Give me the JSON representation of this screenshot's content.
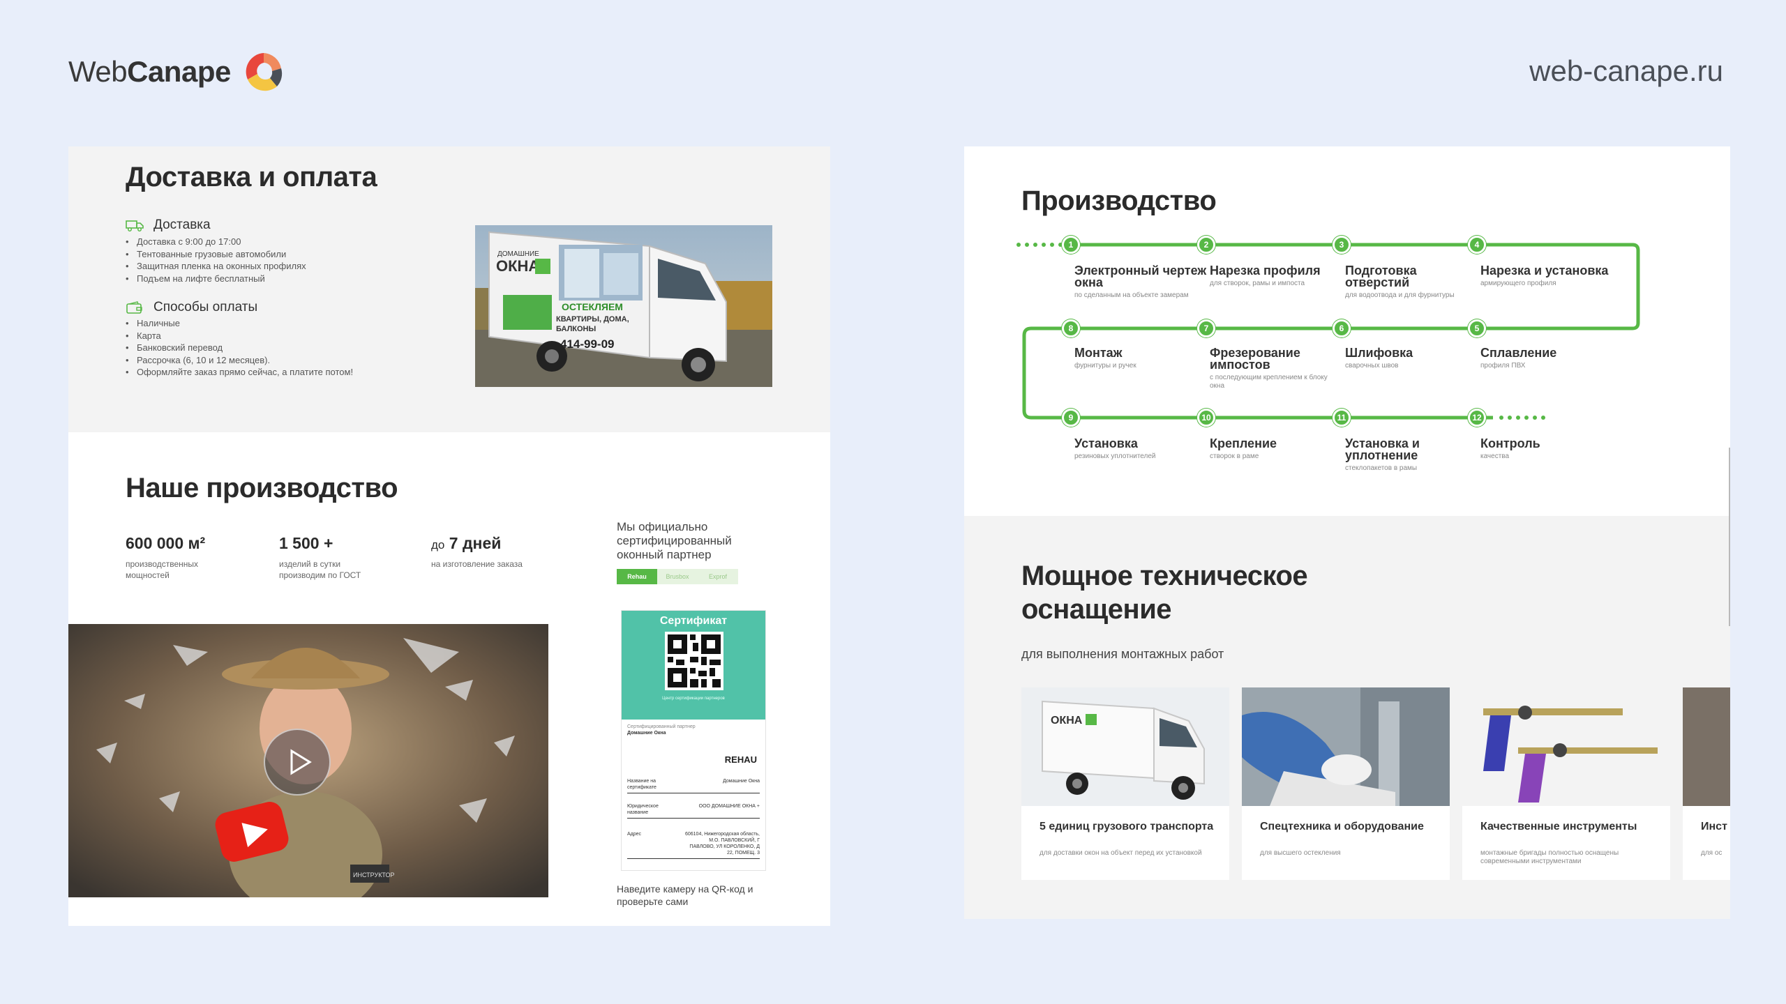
{
  "header": {
    "logo_text_light": "Web",
    "logo_text_bold": "Canape",
    "site_url": "web-canape.ru"
  },
  "left": {
    "delivery_title": "Доставка и оплата",
    "delivery_head": "Доставка",
    "delivery_items": [
      "Доставка с 9:00 до 17:00",
      "Тентованные грузовые автомобили",
      "Защитная пленка на оконных профилях",
      "Подъем на лифте бесплатный"
    ],
    "payment_head": "Способы оплаты",
    "payment_items": [
      "Наличные",
      "Карта",
      "Банковский перевод",
      "Рассрочка (6, 10 и 12 месяцев).",
      "Оформляйте заказ прямо сейчас, а платите потом!"
    ],
    "truck": {
      "brand_small": "ДОМАШНИЕ",
      "brand": "ОКНА",
      "slogan": "ОСТЕКЛЯЕМ",
      "slogan2": "КВАРТИРЫ, ДОМА,",
      "slogan3": "БАЛКОНЫ",
      "phone": "414-99-09"
    },
    "production_title": "Наше производство",
    "stats": [
      {
        "num": "600 000 м²",
        "label1": "производственных",
        "label2": "мощностей"
      },
      {
        "num": "1 500 +",
        "label1": "изделий в сутки",
        "label2": "производим по ГОСТ"
      },
      {
        "num_prefix": "до",
        "num": "7 дней",
        "label1": "на изготовление заказа",
        "label2": ""
      }
    ],
    "partner_text": "Мы официально сертифицированный оконный партнер",
    "brand_tabs": [
      "Rehau",
      "Brusbox",
      "Exprof"
    ],
    "cert": {
      "title": "Сертификат",
      "mini_text": "Центр сертификации партнеров",
      "owner_label": "Сертифицированный партнер",
      "owner": "Домашние Окна",
      "brand": "REHAU",
      "row1_label": "Название на сертификате",
      "row1_value": "Домашние Окна",
      "row2_label": "Юридическое название",
      "row2_value": "ООО ДОМАШНИЕ ОКНА +",
      "row3_label": "Адрес",
      "row3_value": "606104, Нижегородская область, М.О. ПАВЛОВСКИЙ, Г ПАВЛОВО, УЛ КОРОЛЕНКО, Д 22, ПОМЕЩ. 3"
    },
    "cert_note": "Наведите камеру на QR-код и проверьте сами",
    "video_badge": "ИНСТРУКТОР"
  },
  "right": {
    "process_title": "Производство",
    "steps": [
      {
        "n": "1",
        "title": "Электронный чертеж окна",
        "desc": "по сделанным на объекте замерам"
      },
      {
        "n": "2",
        "title": "Нарезка профиля",
        "desc": "для створок, рамы и импоста"
      },
      {
        "n": "3",
        "title": "Подготовка отверстий",
        "desc": "для водоотвода и для фурнитуры"
      },
      {
        "n": "4",
        "title": "Нарезка и установка",
        "desc": "армирующего профиля"
      },
      {
        "n": "5",
        "title": "Сплавление",
        "desc": "профиля ПВХ"
      },
      {
        "n": "6",
        "title": "Шлифовка",
        "desc": "сварочных швов"
      },
      {
        "n": "7",
        "title": "Фрезерование импостов",
        "desc": "с последующим креплением к блоку окна"
      },
      {
        "n": "8",
        "title": "Монтаж",
        "desc": "фурнитуры и ручек"
      },
      {
        "n": "9",
        "title": "Установка",
        "desc": "резиновых уплотнителей"
      },
      {
        "n": "10",
        "title": "Крепление",
        "desc": "створок в раме"
      },
      {
        "n": "11",
        "title": "Установка и уплотнение",
        "desc": "стеклопакетов в рамы"
      },
      {
        "n": "12",
        "title": "Контроль",
        "desc": "качества"
      }
    ],
    "equip_title": "Мощное техническое оснащение",
    "equip_sub": "для выполнения монтажных работ",
    "cards": [
      {
        "title": "5 единиц грузового транспорта",
        "desc": "для доставки окон на объект перед их установкой"
      },
      {
        "title": "Спецтехника и оборудование",
        "desc": "для высшего остекления"
      },
      {
        "title": "Качественные инструменты",
        "desc": "монтажные бригады полностью оснащены современными инструментами"
      },
      {
        "title": "Инст",
        "desc": "для ос"
      }
    ]
  },
  "colors": {
    "accent_green": "#57b846",
    "cert_teal": "#51c2a8",
    "background": "#e8eefa"
  }
}
